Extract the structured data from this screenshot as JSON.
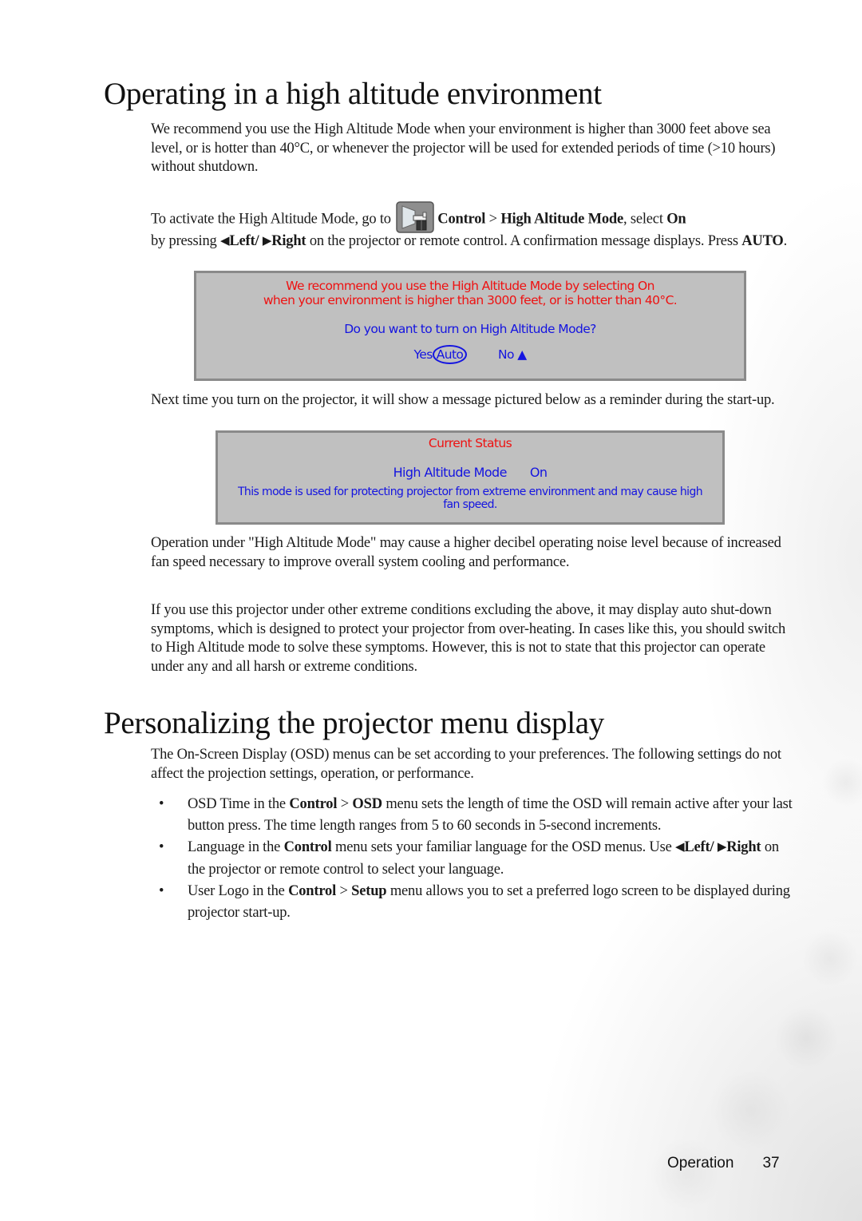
{
  "section1": {
    "title": "Operating in a high altitude environment",
    "intro": "We recommend you use the High Altitude Mode when your environment is higher than 3000 feet above sea level, or is hotter than 40°C, or whenever the projector will be used for extended periods of time (>10 hours) without shutdown.",
    "activate": {
      "prefix": "To activate the High Altitude Mode, go to",
      "icon": "control-menu-icon",
      "menu_control": "Control",
      "sep": ">",
      "menu_item": "High Altitude Mode",
      "select_text": ", select",
      "select_value": "On",
      "by_pressing": "by pressing",
      "left_arrow": "◀",
      "left": "Left",
      "slash": "/",
      "right_arrow": "▶",
      "right": "Right",
      "rest": "on the projector or remote control. A confirmation message displays. Press",
      "auto": "AUTO",
      "period": "."
    },
    "confirm_dialog": {
      "line1": "We recommend you use the High Altitude Mode by selecting On",
      "line2": "when your environment is higher than 3000 feet, or is hotter than 40°C.",
      "question": "Do you want to turn on High Altitude Mode?",
      "yes_label": "Yes",
      "auto_label": "Auto",
      "no_label": "No",
      "up_arrow": "▲",
      "colors": {
        "warning": "#ee1111",
        "info": "#1414e0",
        "background": "#c0c0c0"
      }
    },
    "next_time": "Next time you turn on the projector, it will show a message pictured below as a reminder during the start-up.",
    "status_dialog": {
      "title": "Current Status",
      "mode_label": "High Altitude Mode",
      "mode_value": "On",
      "description_line1": "This mode is used for protecting projector from extreme environment and may cause high",
      "description_line2": "fan speed."
    },
    "noise_note": "Operation under \"High Altitude Mode\" may cause a higher decibel operating noise level because of increased fan speed necessary to improve overall system cooling and performance.",
    "extreme_note": "If you use this projector under other extreme conditions excluding the above, it may display auto shut-down symptoms, which is designed to protect your projector from over-heating. In cases like this, you should switch to High Altitude mode to solve these symptoms. However, this is not to state that this projector can operate under any and all harsh or extreme conditions."
  },
  "section2": {
    "title": "Personalizing the projector menu display",
    "intro": "The On-Screen Display (OSD) menus can be set according to your preferences. The following settings do not affect the projection settings, operation, or performance.",
    "bullets": [
      {
        "lead": "OSD Time in the",
        "menu1": "Control",
        "sep": ">",
        "menu2": "OSD",
        "text": "menu sets the length of time the OSD will remain active after your last button press. The time length ranges from 5 to 60 seconds in 5-second increments."
      },
      {
        "lead": "Language in the",
        "menu1": "Control",
        "text": "menu sets your familiar language for the OSD menus. Use",
        "left_arrow": "◀",
        "left": "Left",
        "slash": "/",
        "right_arrow": "▶",
        "right": "Right",
        "text2": "on the projector or remote control to select your language."
      },
      {
        "lead": "User Logo in the",
        "menu1": "Control",
        "sep": ">",
        "menu2": "Setup",
        "text": "menu allows you to set a preferred logo screen to be displayed during projector start-up."
      }
    ],
    "bullet_char": "•"
  },
  "footer": {
    "section": "Operation",
    "page_number": "37"
  }
}
